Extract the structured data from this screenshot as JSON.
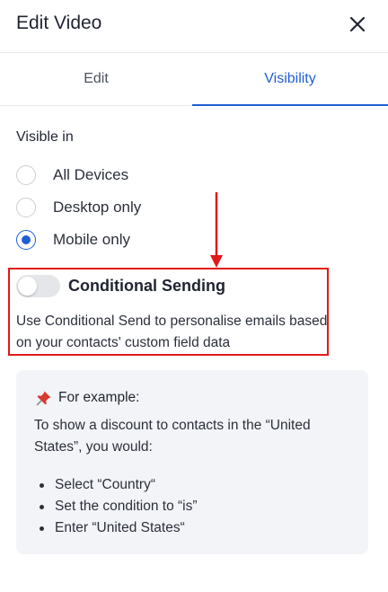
{
  "header": {
    "title": "Edit Video"
  },
  "tabs": [
    {
      "label": "Edit"
    },
    {
      "label": "Visibility"
    }
  ],
  "visibility": {
    "label": "Visible in",
    "options": [
      {
        "label": "All Devices"
      },
      {
        "label": "Desktop only"
      },
      {
        "label": "Mobile only"
      }
    ],
    "selected": "Mobile only"
  },
  "conditional": {
    "title": "Conditional Sending",
    "enabled": false,
    "description": "Use Conditional Send to personalise emails based on your contacts' custom field data"
  },
  "example": {
    "heading": "For example:",
    "intro": "To show a discount to contacts in the “United States”, you would:",
    "steps": [
      "Select “Country“",
      "Set the condition to “is”",
      "Enter “United States“"
    ]
  },
  "colors": {
    "accent": "#1f5fd4",
    "annotation_red": "#e01919",
    "card_bg": "#f3f4f7"
  }
}
